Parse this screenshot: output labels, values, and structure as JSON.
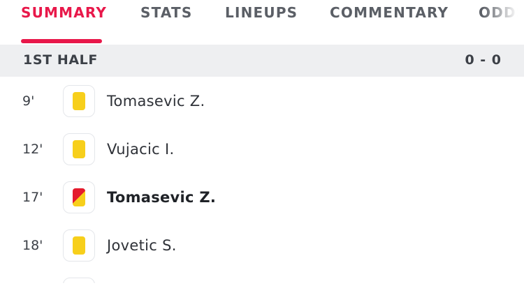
{
  "tabs": [
    {
      "label": "SUMMARY",
      "active": true
    },
    {
      "label": "STATS",
      "active": false
    },
    {
      "label": "LINEUPS",
      "active": false
    },
    {
      "label": "COMMENTARY",
      "active": false
    },
    {
      "label": "ODDS",
      "active": false
    }
  ],
  "colors": {
    "accent": "#e8184a",
    "yellow_card": "#f7cf1b",
    "red_card": "#e41b2d",
    "section_bg": "#eeeff1"
  },
  "section": {
    "title": "1ST HALF",
    "score": "0 - 0"
  },
  "events": [
    {
      "minute": "9'",
      "card": "yellow-card-icon",
      "player": "Tomasevic Z."
    },
    {
      "minute": "12'",
      "card": "yellow-card-icon",
      "player": "Vujacic I."
    },
    {
      "minute": "17'",
      "card": "second-yellow-red-card-icon",
      "player": "Tomasevic Z."
    },
    {
      "minute": "18'",
      "card": "yellow-card-icon",
      "player": "Jovetic S."
    }
  ]
}
